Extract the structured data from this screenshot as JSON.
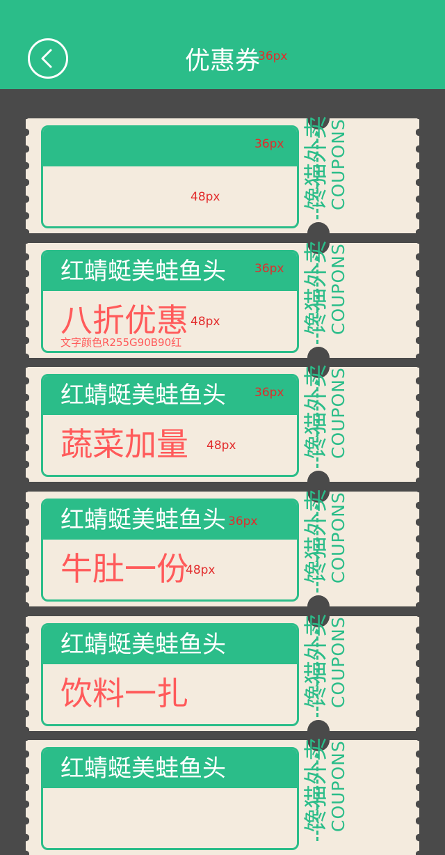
{
  "header": {
    "title": "优惠券",
    "title_size_note": "36px",
    "back_icon": "chevron-left-icon"
  },
  "coupons": [
    {
      "shop_name": "",
      "offer": "",
      "size_note_name": "36px",
      "size_note_offer": "48px",
      "color_note": ""
    },
    {
      "shop_name": "红蜻蜓美蛙鱼头",
      "offer": "八折优惠",
      "size_note_name": "36px",
      "size_note_offer": "48px",
      "color_note": "文字颜色R255G90B90红"
    },
    {
      "shop_name": "红蜻蜓美蛙鱼头",
      "offer": "蔬菜加量",
      "size_note_name": "36px",
      "size_note_offer": "48px",
      "color_note": ""
    },
    {
      "shop_name": "红蜻蜓美蛙鱼头",
      "offer": "牛肚一份",
      "size_note_name": "36px",
      "size_note_offer": "48px",
      "color_note": ""
    },
    {
      "shop_name": "红蜻蜓美蛙鱼头",
      "offer": "饮料一扎",
      "size_note_name": "",
      "size_note_offer": "",
      "color_note": ""
    },
    {
      "shop_name": "红蜻蜓美蛙鱼头",
      "offer": "",
      "size_note_name": "",
      "size_note_offer": "",
      "color_note": ""
    }
  ],
  "brand": {
    "cn": "馋猫外卖",
    "en": "COUPONS"
  },
  "colors": {
    "accent": "#2bbd89",
    "background": "#4a4a4a",
    "ticket": "#f4ebde",
    "offer_text": "#ff5a5a",
    "annotation": "#e22b2b"
  }
}
